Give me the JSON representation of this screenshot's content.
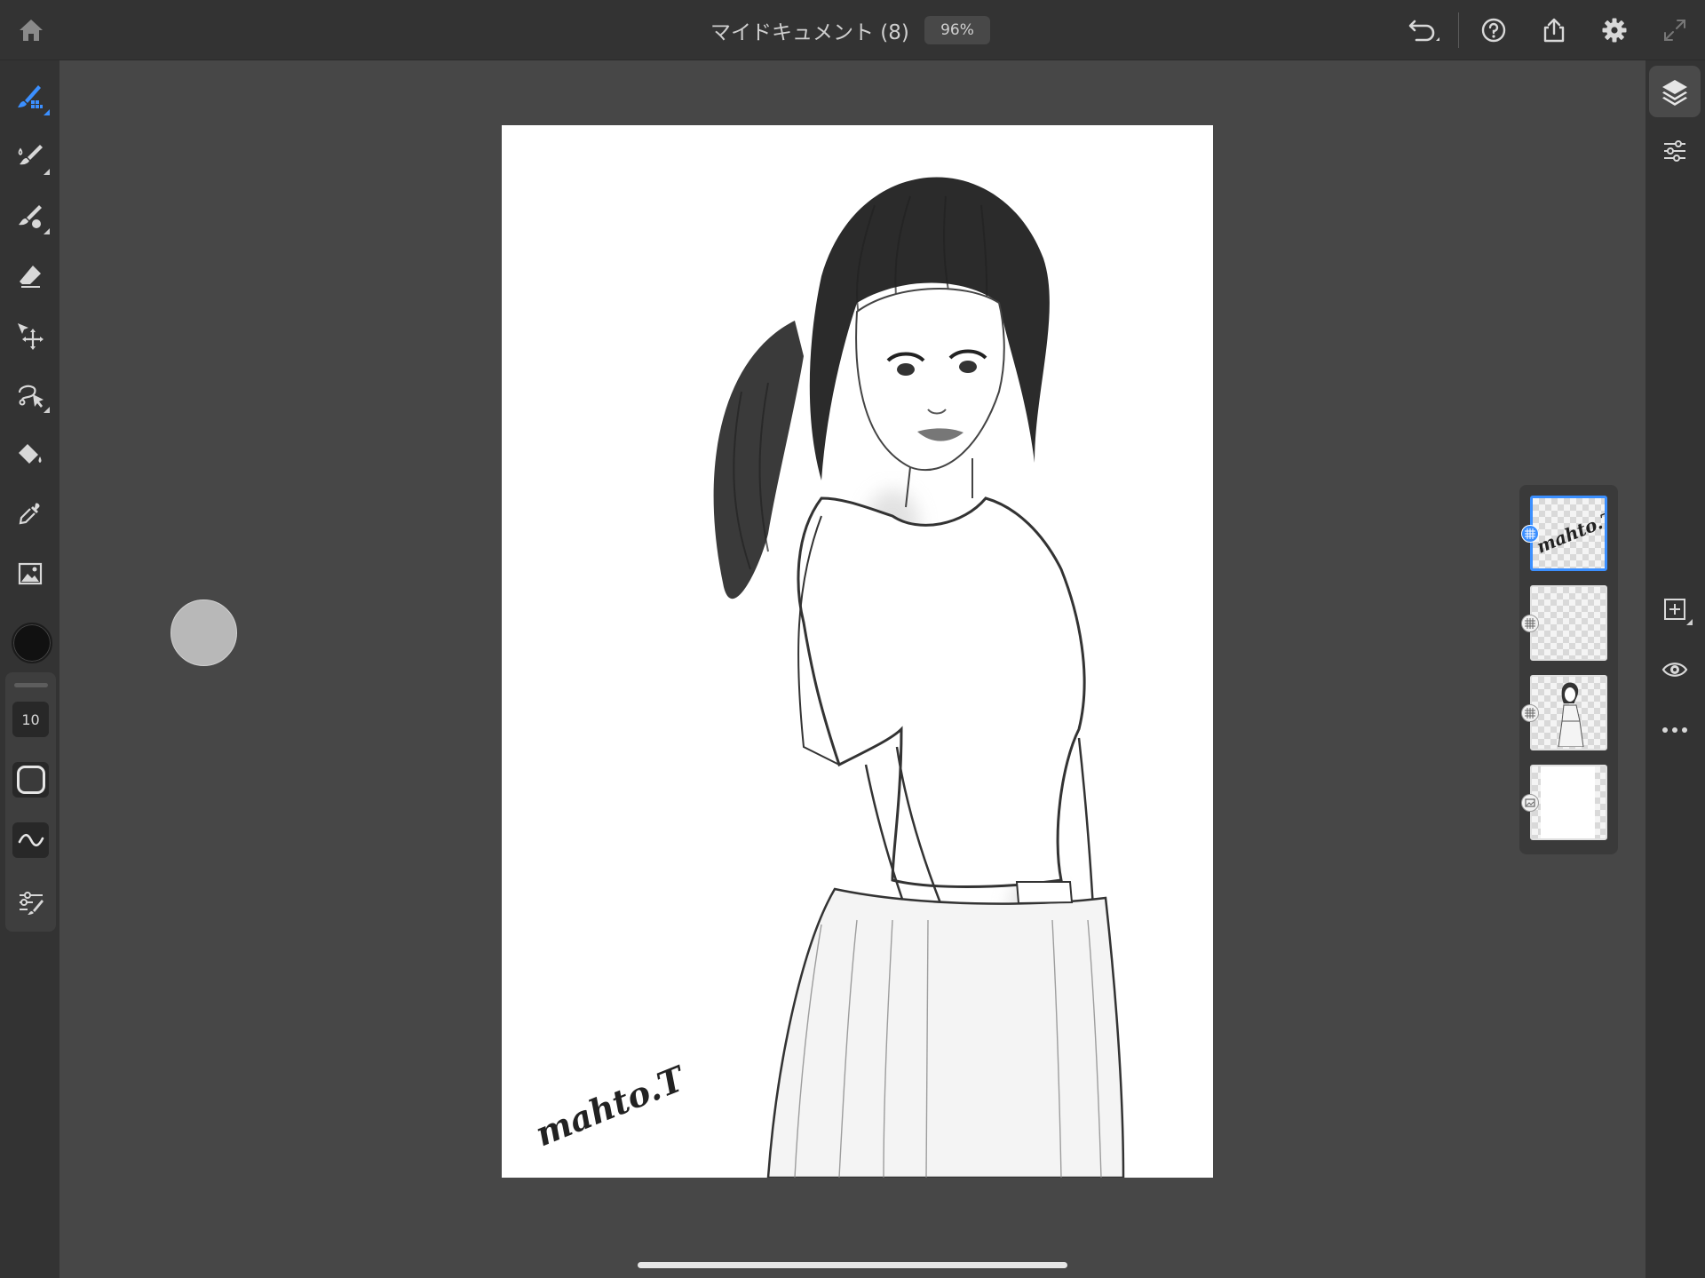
{
  "header": {
    "document_title": "マイドキュメント (8)",
    "zoom_level": "96%"
  },
  "toolbar": {
    "tools": [
      {
        "name": "pixel-brush",
        "icon": "pixel-brush-icon",
        "active": true
      },
      {
        "name": "live-brush",
        "icon": "watercolor-brush-icon",
        "active": false
      },
      {
        "name": "vector-brush",
        "icon": "vector-brush-icon",
        "active": false
      },
      {
        "name": "eraser",
        "icon": "eraser-icon",
        "active": false
      },
      {
        "name": "transform",
        "icon": "move-icon",
        "active": false
      },
      {
        "name": "selection",
        "icon": "lasso-icon",
        "active": false
      },
      {
        "name": "fill",
        "icon": "paint-bucket-icon",
        "active": false
      },
      {
        "name": "eyedropper",
        "icon": "eyedropper-icon",
        "active": false
      },
      {
        "name": "image",
        "icon": "image-icon",
        "active": false
      }
    ],
    "current_color": "#111111",
    "brush_size": "10",
    "accent_color": "#3b8fff"
  },
  "canvas": {
    "signature": "mahto.T"
  },
  "layers": {
    "selected_index": 0,
    "items": [
      {
        "name": "signature-layer",
        "content": "mahto.T"
      },
      {
        "name": "empty-layer",
        "content": ""
      },
      {
        "name": "sketch-layer",
        "content": ""
      },
      {
        "name": "background-layer",
        "content": ""
      }
    ]
  }
}
